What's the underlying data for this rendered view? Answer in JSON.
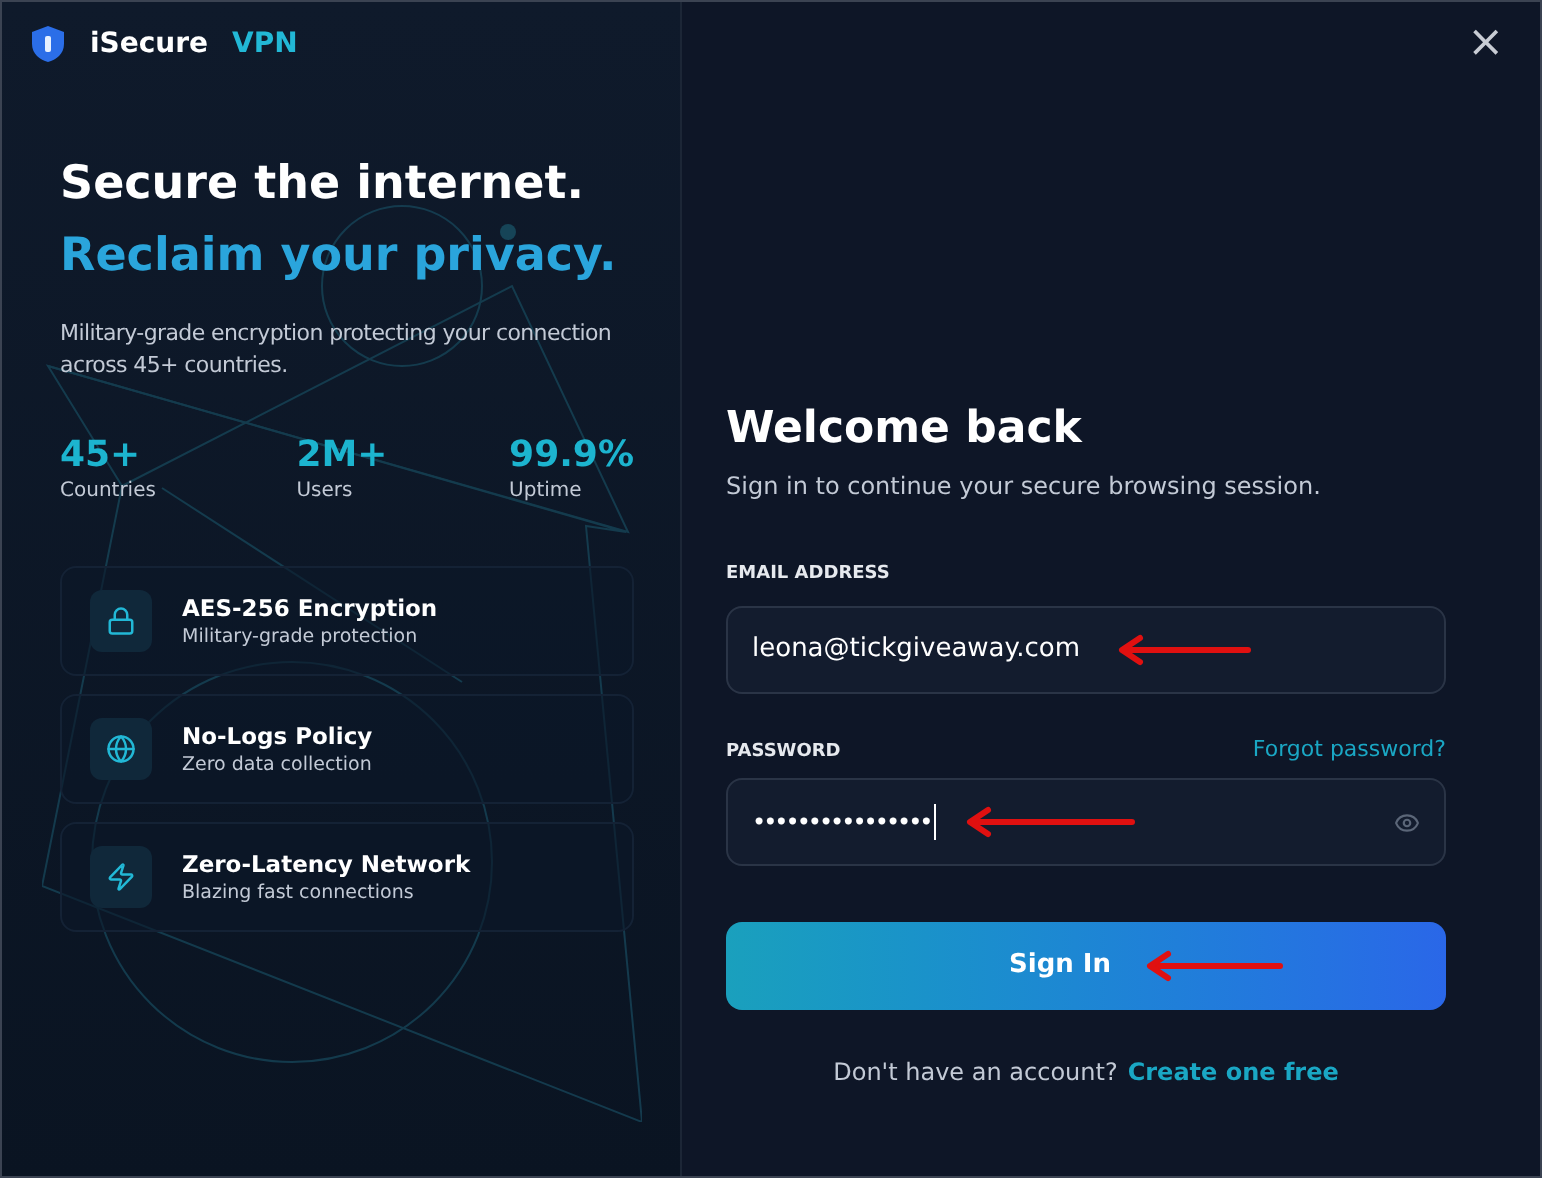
{
  "window": {
    "brand": "iSecure",
    "brand_accent": "VPN",
    "close": "×"
  },
  "hero": {
    "title": "Secure the internet.",
    "subtitle": "Reclaim your privacy.",
    "description": "Military-grade encryption protecting your connection across 45+ countries."
  },
  "stats": [
    {
      "value": "45+",
      "label": "Countries"
    },
    {
      "value": "2M+",
      "label": "Users"
    },
    {
      "value": "99.9%",
      "label": "Uptime"
    }
  ],
  "features": [
    {
      "kind": "lock",
      "title": "AES-256 Encryption",
      "subtitle": "Military-grade protection"
    },
    {
      "kind": "globe",
      "title": "No-Logs Policy",
      "subtitle": "Zero data collection"
    },
    {
      "kind": "bolt",
      "title": "Zero-Latency Network",
      "subtitle": "Blazing fast connections"
    }
  ],
  "login": {
    "title": "Welcome back",
    "subtitle": "Sign in to continue your secure browsing session.",
    "email_label": "EMAIL ADDRESS",
    "email_value": "leona@tickgiveaway.com",
    "password_label": "PASSWORD",
    "forgot": "Forgot password?",
    "password_value": "••••••••••••••••",
    "sign_in": "Sign In",
    "signup_prompt": "Don't have an account?",
    "signup_link": "Create one free"
  }
}
